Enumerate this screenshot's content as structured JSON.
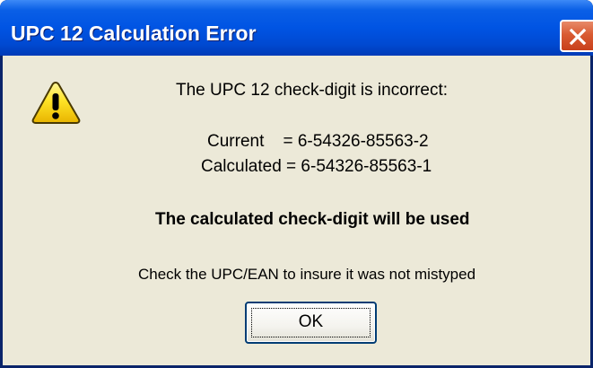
{
  "window": {
    "title": "UPC 12 Calculation Error",
    "close_icon": "close-icon"
  },
  "message": {
    "icon": "warning-icon",
    "heading": "The UPC 12 check-digit is incorrect:",
    "current_line": "Current    = 6-54326-85563-2",
    "calculated_line": "Calculated = 6-54326-85563-1",
    "notice": "The calculated check-digit will be used",
    "hint": "Check the UPC/EAN to insure it was not mistyped"
  },
  "buttons": {
    "ok_label": "OK"
  },
  "colors": {
    "titlebar": "#0054e3",
    "close_button": "#d95b32",
    "dialog_background": "#ece9d8",
    "warning_yellow": "#ffd800"
  }
}
